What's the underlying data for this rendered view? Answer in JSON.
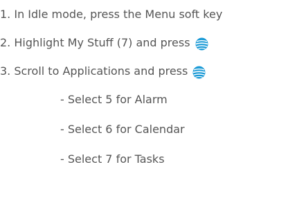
{
  "steps": [
    {
      "text": "1. In Idle mode, press the Menu soft key"
    },
    {
      "text": "2. Highlight My Stuff (7) and press",
      "icon": "att-globe-icon"
    },
    {
      "text": "3. Scroll to Applications and press",
      "icon": "att-globe-icon"
    }
  ],
  "substeps": [
    {
      "text": "- Select 5 for Alarm"
    },
    {
      "text": "- Select 6 for Calendar"
    },
    {
      "text": "- Select 7 for Tasks"
    }
  ],
  "colors": {
    "text": "#555555",
    "icon_blue": "#1a9ad6"
  }
}
